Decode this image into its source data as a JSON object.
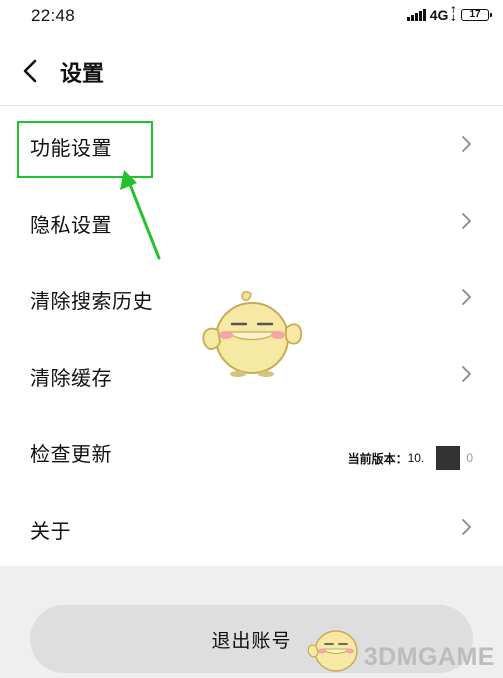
{
  "status_bar": {
    "time": "22:48",
    "network": "4G",
    "battery": "17"
  },
  "header": {
    "title": "设置"
  },
  "settings": {
    "items": [
      {
        "label": "功能设置"
      },
      {
        "label": "隐私设置"
      },
      {
        "label": "清除搜索历史"
      },
      {
        "label": "清除缓存"
      },
      {
        "label": "检查更新"
      },
      {
        "label": "关于"
      }
    ],
    "version_label": "当前版本：",
    "version_value": "10.",
    "version_suffix": "0"
  },
  "logout": {
    "label": "退出账号"
  },
  "watermark": {
    "text": "3DMGAME"
  },
  "colors": {
    "highlight": "#22c22a",
    "arrow": "#22c22a"
  },
  "icons": {
    "back": "chevron-left-icon",
    "row": "chevron-right-icon"
  }
}
